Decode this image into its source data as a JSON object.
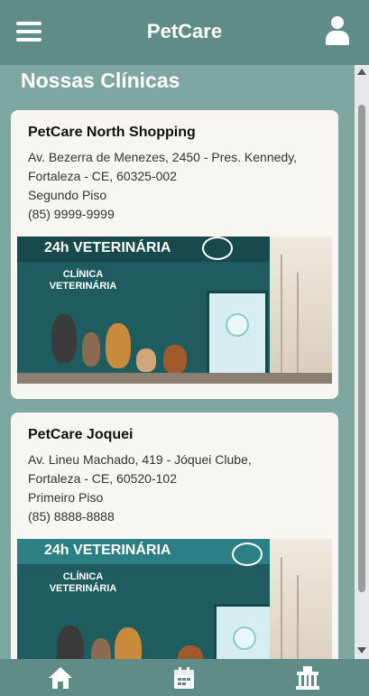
{
  "app": {
    "title": "PetCare"
  },
  "page": {
    "heading": "Nossas Clínicas"
  },
  "clinics": [
    {
      "name": "PetCare North Shopping",
      "address_line1": "Av. Bezerra de Menezes, 2450 - Pres. Kennedy,",
      "address_line2": "Fortaleza - CE, 60325-002",
      "floor": "Segundo Piso",
      "phone": "(85) 9999-9999",
      "photo": {
        "banner": "24h VETERINÁRIA",
        "sign": "CLÍNICA VETERINÁRIA"
      }
    },
    {
      "name": "PetCare Joquei",
      "address_line1": "Av. Lineu Machado, 419 - Jóquei Clube,",
      "address_line2": "Fortaleza - CE, 60520-102",
      "floor": "Primeiro Piso",
      "phone": "(85) 8888-8888",
      "photo": {
        "banner": "24h VETERINÁRIA",
        "sign": "CLÍNICA VETERINÁRIA"
      }
    }
  ],
  "nav": {
    "items": [
      "home-icon",
      "calendar-icon",
      "clinic-icon"
    ]
  },
  "colors": {
    "header": "#5f8c86",
    "background": "#7fa7a1",
    "card": "#f8f6f3"
  }
}
